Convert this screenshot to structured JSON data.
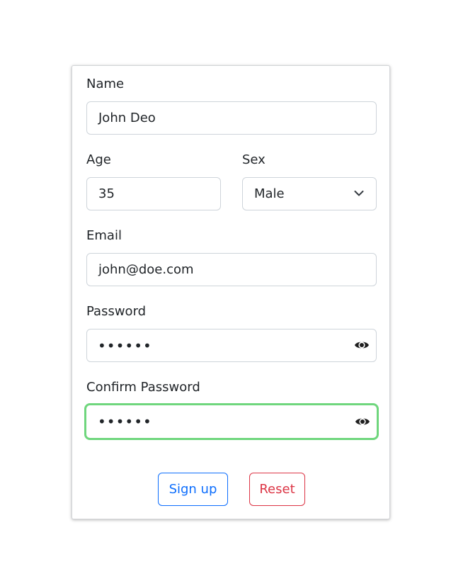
{
  "form": {
    "name_label": "Name",
    "name_value": "John Deo",
    "age_label": "Age",
    "age_value": "35",
    "sex_label": "Sex",
    "sex_value": "Male",
    "email_label": "Email",
    "email_value": "john@doe.com",
    "password_label": "Password",
    "password_masked": "••••••",
    "confirm_label": "Confirm Password",
    "confirm_masked": "••••••"
  },
  "buttons": {
    "signup_label": "Sign up",
    "reset_label": "Reset"
  },
  "colors": {
    "primary": "#0d6efd",
    "danger": "#dc3545",
    "focus_border": "#6fd67d"
  }
}
